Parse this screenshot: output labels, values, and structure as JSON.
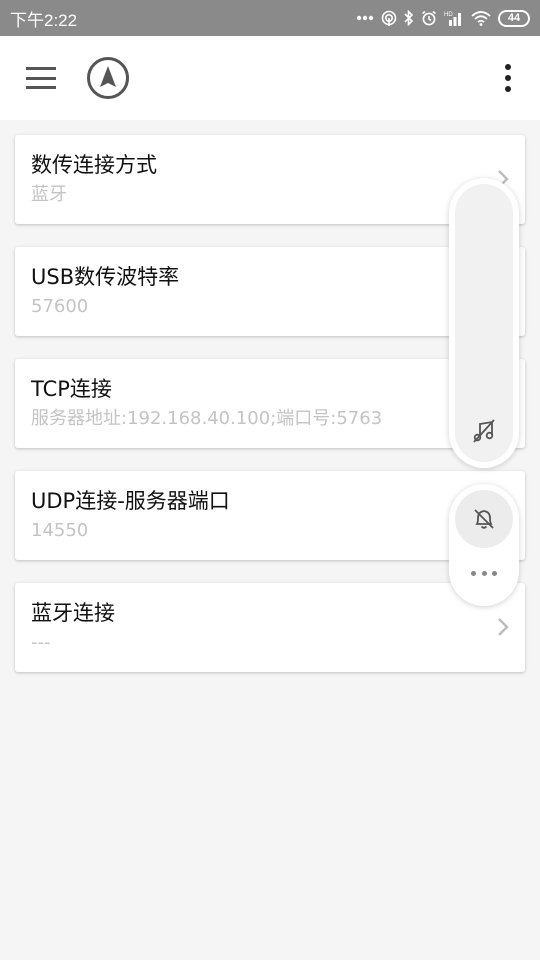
{
  "status_bar": {
    "time": "下午2:22",
    "icons": [
      "dots-icon",
      "hotspot-icon",
      "bluetooth-icon",
      "alarm-icon",
      "signal-icon",
      "wifi-icon"
    ],
    "battery": "44"
  },
  "app_bar": {
    "icons": [
      "menu-icon",
      "navigation-logo-icon",
      "more-vert-icon"
    ]
  },
  "settings": [
    {
      "title": "数传连接方式",
      "subtitle": "蓝牙"
    },
    {
      "title": "USB数传波特率",
      "subtitle": "57600"
    },
    {
      "title": "TCP连接",
      "subtitle": "服务器地址:192.168.40.100;端口号:5763"
    },
    {
      "title": "UDP连接-服务器端口",
      "subtitle": "14550"
    },
    {
      "title": "蓝牙连接",
      "subtitle": "---"
    }
  ],
  "floating_panel": {
    "icons": [
      "music-off-icon",
      "bell-off-icon",
      "more-horiz-icon"
    ]
  },
  "colors": {
    "status_bar_bg": "#8a8a8a",
    "background": "#f5f5f5",
    "subtitle": "#c4c4c4"
  }
}
